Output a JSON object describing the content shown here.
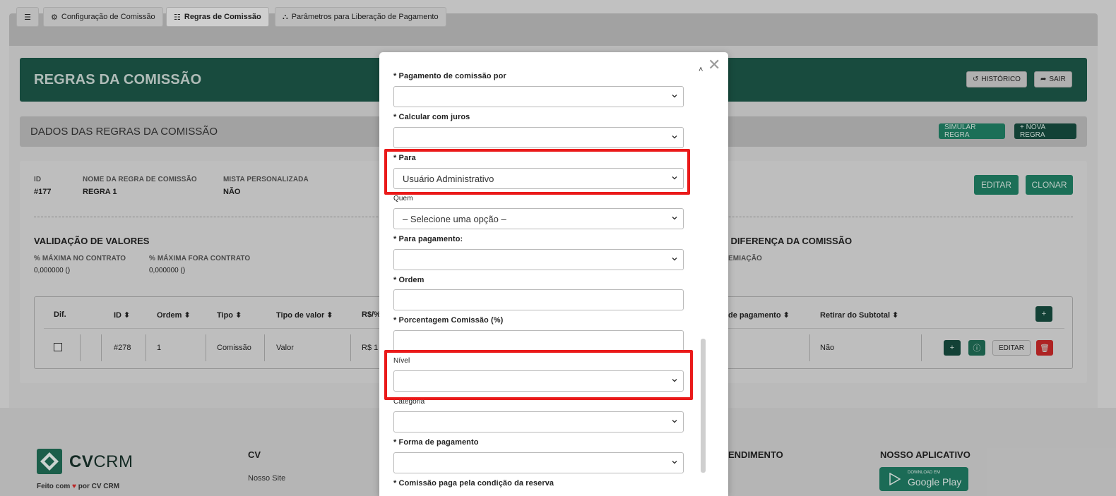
{
  "tabs": [
    {
      "label": "Configuração de Comissão",
      "icon": "gear-icon"
    },
    {
      "label": "Regras de Comissão",
      "icon": "list-icon"
    },
    {
      "label": "Parâmetros para Liberação de Pagamento",
      "icon": "sitemap-icon"
    }
  ],
  "menu_glyph": "☰",
  "header": {
    "title": "REGRAS DA COMISSÃO",
    "historico_label": "HISTÓRICO",
    "sair_label": "SAIR"
  },
  "subheader": {
    "title": "DADOS DAS REGRAS DA COMISSÃO",
    "simular_label": "SIMULAR REGRA",
    "nova_label": "+ NOVA REGRA"
  },
  "rule": {
    "id_label": "ID",
    "id_value": "#177",
    "nome_label": "NOME DA REGRA DE COMISSÃO",
    "nome_value": "REGRA 1",
    "mista_label": "MISTA PERSONALIZADA",
    "mista_value": "NÃO",
    "editar_label": "EDITAR",
    "clonar_label": "CLONAR"
  },
  "validacao": {
    "title": "VALIDAÇÃO DE VALORES",
    "max_contrato_label": "% MÁXIMA NO CONTRATO",
    "max_contrato_value": "0,000000 ()",
    "max_fora_label": "% MÁXIMA FORA CONTRATO",
    "max_fora_value": "0,000000 ()",
    "diferenca_title": "A DIFERENÇA DA COMISSÃO",
    "premiacao_label": "EMIAÇÃO"
  },
  "table": {
    "headers": [
      "Dif.",
      "ID ⬍",
      "Ordem ⬍",
      "Tipo ⬍",
      "Tipo de valor ⬍",
      "R$/%",
      "de pagamento ⬍",
      "Retirar do Subtotal ⬍"
    ],
    "row": {
      "id": "#278",
      "ordem": "1",
      "tipo": "Comissão",
      "tipo_valor": "Valor",
      "rs": "R$ 1",
      "retirar": "Não",
      "editar_label": "EDITAR"
    }
  },
  "footer": {
    "logo_cv": "CV",
    "logo_crm": "CRM",
    "tagline_pre": "Feito com",
    "tagline_post": "por CV CRM",
    "col_cv_title": "CV",
    "col_cv_link": "Nosso Site",
    "col_atend_title": "ENDIMENTO",
    "col_app_title": "NOSSO APLICATIVO",
    "gplay_small": "DOWNLOAD EM",
    "gplay_big": "Google Play"
  },
  "modal": {
    "fields": [
      {
        "label": "* Pagamento de comissão por",
        "value": ""
      },
      {
        "label": "* Calcular com juros",
        "value": ""
      },
      {
        "label": "* Para",
        "value": "Usuário Administrativo"
      },
      {
        "label": "Quem",
        "value": "– Selecione uma opção –"
      },
      {
        "label": "* Para pagamento:",
        "value": ""
      },
      {
        "label": "* Ordem",
        "value": ""
      },
      {
        "label": "* Porcentagem Comissão (%)",
        "value": ""
      },
      {
        "label": "Nível",
        "value": ""
      },
      {
        "label": "Categoria",
        "value": ""
      },
      {
        "label": "* Forma de pagamento",
        "value": ""
      },
      {
        "label": "* Comissão paga pela condição da reserva",
        "value": ""
      }
    ],
    "close_glyph": "✕",
    "caret_glyph": "˄"
  },
  "colors": {
    "primary_dark": "#1c5647",
    "primary": "#1f7f64",
    "danger": "#c62828",
    "highlight": "#ea1a1a"
  }
}
